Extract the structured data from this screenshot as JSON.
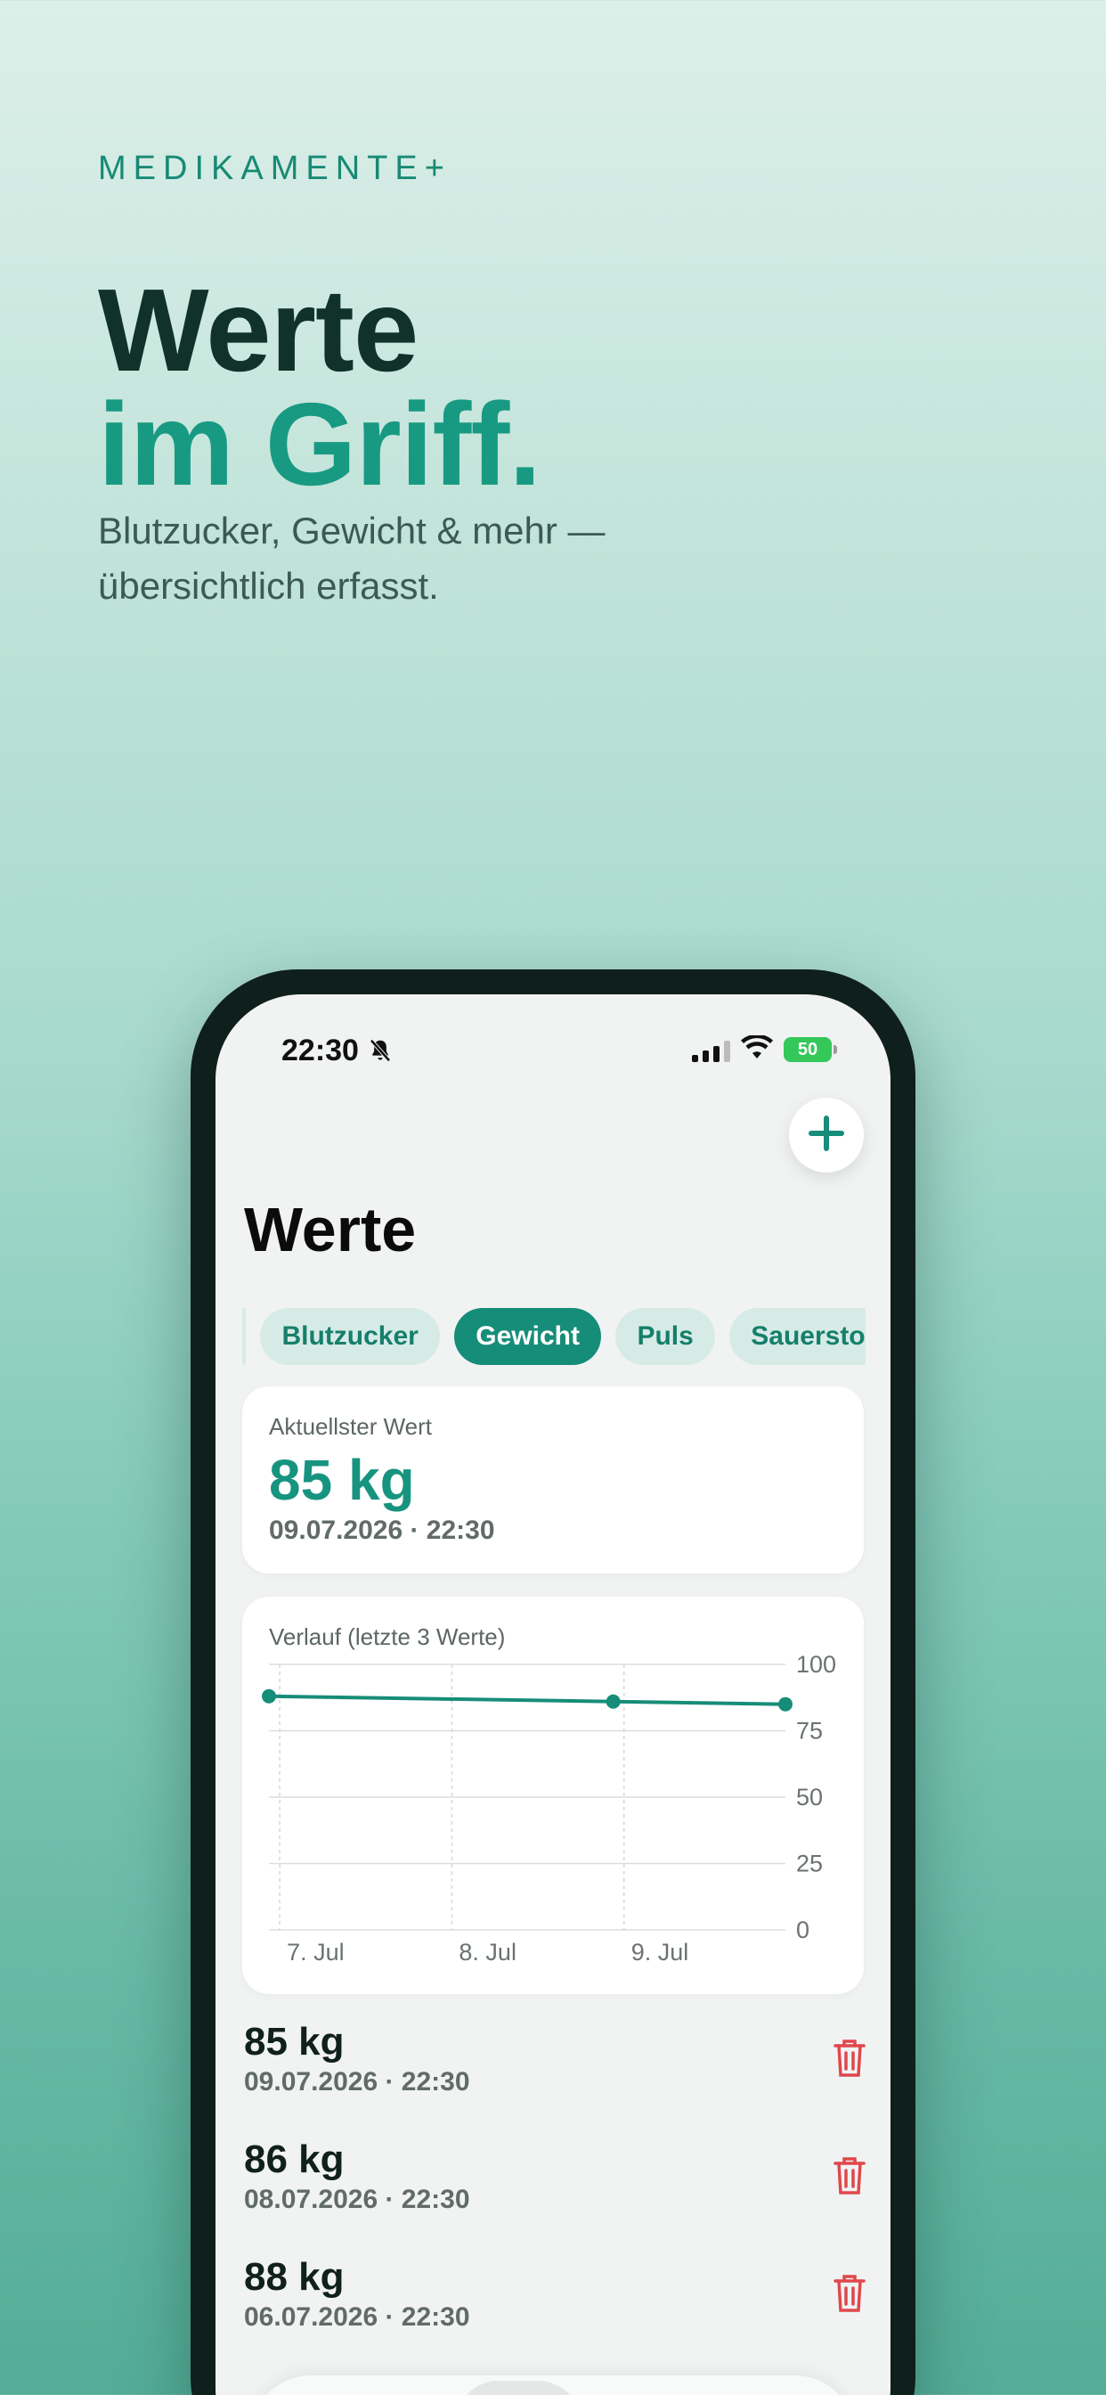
{
  "hero": {
    "brand": "MEDIKAMENTE+",
    "headline_1": "Werte",
    "headline_2": "im Griff.",
    "sub_1": "Blutzucker, Gewicht & mehr —",
    "sub_2": "übersichtlich erfasst."
  },
  "status_bar": {
    "time": "22:30",
    "battery": "50"
  },
  "colors": {
    "accent": "#168d78",
    "accent_text": "#179480",
    "dark": "#10322b",
    "danger": "#e0474c"
  },
  "page": {
    "title": "Werte",
    "add_icon": "plus-icon"
  },
  "filters": [
    {
      "label": "Blutzucker",
      "active": false
    },
    {
      "label": "Gewicht",
      "active": true
    },
    {
      "label": "Puls",
      "active": false
    },
    {
      "label": "Sauerstoff",
      "active": false
    }
  ],
  "latest": {
    "label": "Aktuellster Wert",
    "value": "85 kg",
    "date": "09.07.2026 · 22:30"
  },
  "chart_data": {
    "type": "line",
    "title": "Verlauf (letzte 3 Werte)",
    "x": [
      "06.07.2026 22:30",
      "08.07.2026 22:30",
      "09.07.2026 22:30"
    ],
    "x_ticks": [
      "7. Jul",
      "8. Jul",
      "9. Jul"
    ],
    "y_ticks": [
      0,
      25,
      50,
      75,
      100
    ],
    "ylim": [
      0,
      100
    ],
    "series": [
      {
        "values": [
          88,
          86,
          85
        ]
      }
    ],
    "grid": true
  },
  "entries": [
    {
      "value": "85 kg",
      "date": "09.07.2026 · 22:30"
    },
    {
      "value": "86 kg",
      "date": "08.07.2026 · 22:30"
    },
    {
      "value": "88 kg",
      "date": "06.07.2026 · 22:30"
    }
  ],
  "tabs": [
    {
      "icon": "checklist-icon",
      "active": false
    },
    {
      "icon": "calendar-icon",
      "active": false
    },
    {
      "icon": "health-record-icon",
      "active": true
    },
    {
      "icon": "pills-icon",
      "active": false
    },
    {
      "icon": "profile-icon",
      "active": false
    }
  ]
}
